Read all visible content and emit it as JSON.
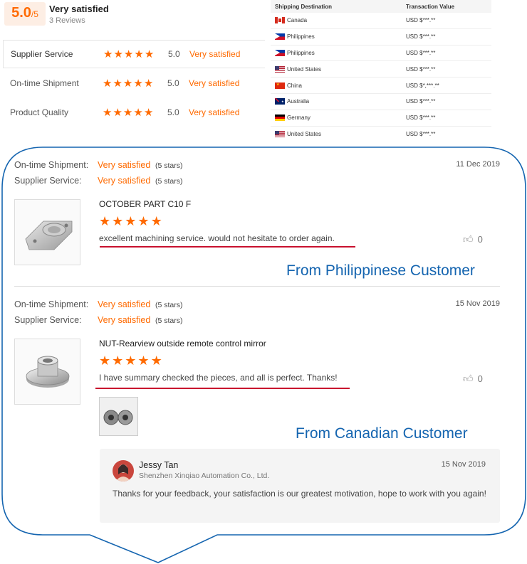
{
  "summary": {
    "score": "5.0",
    "score_of": "/5",
    "title": "Very satisfied",
    "reviews": "3 Reviews",
    "rows": [
      {
        "label": "Supplier Service",
        "score": "5.0",
        "text": "Very satisfied",
        "stars": 5
      },
      {
        "label": "On-time Shipment",
        "score": "5.0",
        "text": "Very satisfied",
        "stars": 5
      },
      {
        "label": "Product Quality",
        "score": "5.0",
        "text": "Very satisfied",
        "stars": 5
      }
    ]
  },
  "shipping": {
    "headers": [
      "Shipping Destination",
      "Transaction Value"
    ],
    "rows": [
      {
        "country": "Canada",
        "value": "USD $***.**"
      },
      {
        "country": "Philippines",
        "value": "USD $***.**"
      },
      {
        "country": "Philippines",
        "value": "USD $***.**"
      },
      {
        "country": "United States",
        "value": "USD $***.**"
      },
      {
        "country": "China",
        "value": "USD $*,***.**"
      },
      {
        "country": "Australia",
        "value": "USD $***.**"
      },
      {
        "country": "Germany",
        "value": "USD $***.**"
      },
      {
        "country": "United States",
        "value": "USD $***.**"
      }
    ]
  },
  "reviews": [
    {
      "shipment_label": "On-time Shipment:",
      "shipment_sat": "Very satisfied",
      "shipment_stars": "(5 stars)",
      "service_label": "Supplier Service:",
      "service_sat": "Very satisfied",
      "service_stars": "(5 stars)",
      "date": "11 Dec 2019",
      "product": "OCTOBER PART C10 F",
      "rating": 5,
      "text": "excellent machining service. would not hesitate to order again.",
      "likes": "0",
      "origin_note": "From Philippinese Customer"
    },
    {
      "shipment_label": "On-time Shipment:",
      "shipment_sat": "Very satisfied",
      "shipment_stars": "(5 stars)",
      "service_label": "Supplier Service:",
      "service_sat": "Very satisfied",
      "service_stars": "(5 stars)",
      "date": "15 Nov 2019",
      "product": "NUT-Rearview outside remote control mirror",
      "rating": 5,
      "text": "I have summary checked the pieces, and all is perfect. Thanks!",
      "likes": "0",
      "origin_note": "From Canadian Customer"
    }
  ],
  "reply": {
    "name": "Jessy Tan",
    "company": "Shenzhen Xinqiao Automation Co., Ltd.",
    "date": "15 Nov 2019",
    "text": "Thanks for your feedback, your satisfaction is our greatest motivation, hope to work with you again!"
  },
  "colors": {
    "accent": "#ff6a00",
    "annotation_blue": "#1565b0",
    "underline_red": "#c8102e"
  }
}
